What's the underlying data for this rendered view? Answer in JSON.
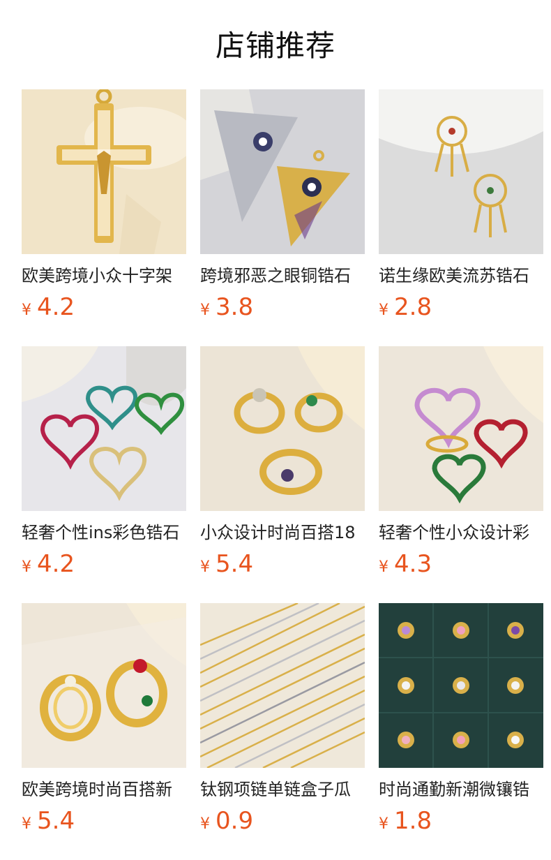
{
  "page": {
    "title": "店铺推荐"
  },
  "colors": {
    "price": "#e8541e",
    "text": "#222222"
  },
  "products": [
    {
      "name": "欧美跨境小众十字架",
      "currency": "¥",
      "price": "4.2",
      "icon": "cross-pendant-image",
      "bg": "#f1e6cf"
    },
    {
      "name": "跨境邪恶之眼铜锆石",
      "currency": "¥",
      "price": "3.8",
      "icon": "evil-eye-pendant-image",
      "bg": "#d9d9dc"
    },
    {
      "name": "诺生缘欧美流苏锆石",
      "currency": "¥",
      "price": "2.8",
      "icon": "dreamcatcher-pendant-image",
      "bg": "#dadada"
    },
    {
      "name": "轻奢个性ins彩色锆石",
      "currency": "¥",
      "price": "4.2",
      "icon": "heart-pendants-image",
      "bg": "#e4e3e6"
    },
    {
      "name": "小众设计时尚百搭18",
      "currency": "¥",
      "price": "5.4",
      "icon": "snake-rings-image",
      "bg": "#e9e2d6"
    },
    {
      "name": "轻奢个性小众设计彩",
      "currency": "¥",
      "price": "4.3",
      "icon": "heart-rings-image",
      "bg": "#ebe4d8"
    },
    {
      "name": "欧美跨境时尚百搭新",
      "currency": "¥",
      "price": "5.4",
      "icon": "stacked-rings-image",
      "bg": "#ece4d6"
    },
    {
      "name": "钛钢项链单链盒子瓜",
      "currency": "¥",
      "price": "0.9",
      "icon": "chain-necklaces-image",
      "bg": "#ede6d8"
    },
    {
      "name": "时尚通勤新潮微镶锆",
      "currency": "¥",
      "price": "1.8",
      "icon": "charm-pendants-image",
      "bg": "#23413d"
    }
  ]
}
